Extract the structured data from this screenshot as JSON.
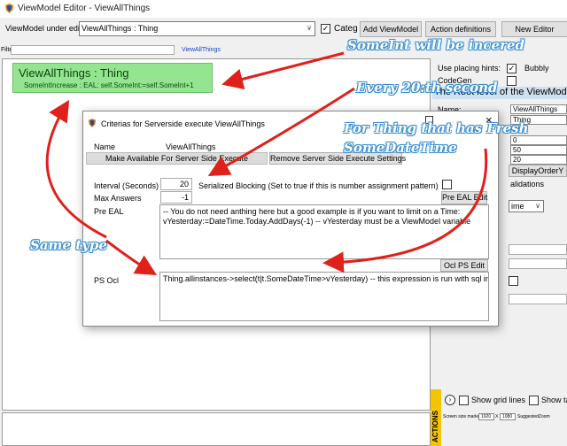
{
  "window": {
    "title": "ViewModel Editor - ViewAllThings"
  },
  "toolbar": {
    "edit_label": "ViewModel under edit:",
    "edit_value": "ViewAllThings : Thing",
    "categ_label": "Categ",
    "categ_checked": true,
    "add_viewmodel": "Add ViewModel",
    "action_definitions": "Action definitions",
    "new_editor": "New Editor"
  },
  "filter": {
    "label": "Filter:",
    "link": "ViewAllThings"
  },
  "viewnode": {
    "header": "ViewAllThings : Thing",
    "row": "SomeIntIncrease : EAL: self.SomeInt:=self.SomeInt+1"
  },
  "rightpanel": {
    "use_placing_hints": "Use placing hints:",
    "bubbly": "Bubbly",
    "codegen": "CodeGen",
    "root_level": "The Root level of the ViewModel",
    "name_label": "Name:",
    "name_value": "ViewAllThings",
    "thing_value": "Thing",
    "values": [
      "0",
      "50",
      "20"
    ],
    "display_order": "DisplayOrderY",
    "validations": "alidations",
    "time_combo": "ime",
    "show_grid_lines": "Show grid lines",
    "show_t": "Show ta",
    "screen_size": "Screen size marker",
    "screen_w": "1920",
    "screen_h": "1080",
    "suggested_zoom": "SuggestedZoom",
    "actions_tab": "ACTIONS"
  },
  "dialog": {
    "title": "Criterias for Serverside execute ViewAllThings",
    "name_label": "Name",
    "name_value": "ViewAllThings",
    "make_available": "Make Available For Server Side Execute",
    "remove_settings": "Remove Server Side Execute Settings",
    "interval_label": "Interval (Seconds)",
    "interval_value": "20",
    "serialized_blocking": "Serialized Blocking (Set to true if this is number assignment pattern)",
    "max_answers_label": "Max Answers",
    "max_answers_value": "-1",
    "pre_eal_label": "Pre EAL",
    "pre_eal_edit": "Pre EAL Edit",
    "pre_eal_text_line1": "-- You do not need anthing here but a good example is if you want to limit on a Time:",
    "pre_eal_text_line2": "vYesterday:=DateTime.Today.AddDays(-1)  -- vYesterday must be a ViewModel variable",
    "ocl_ps_edit": "Ocl PS Edit",
    "ps_ocl_label": "PS Ocl",
    "ps_ocl_text": "Thing.allinstances->select(t|t.SomeDateTime>vYesterday)  -- this expression is run with sql in db"
  },
  "annotations": {
    "someint": "SomeInt will be incered",
    "every20": "Every 20:th second",
    "forthing_line1": "For Thing that has Fresh",
    "forthing_line2": "SomeDateTime",
    "sametype": "Same type"
  },
  "colors": {
    "node_green": "#93e68f",
    "annotation_blue": "#3c8fd0",
    "arrow_red": "#e0201a",
    "actions_yellow": "#f5c400"
  }
}
